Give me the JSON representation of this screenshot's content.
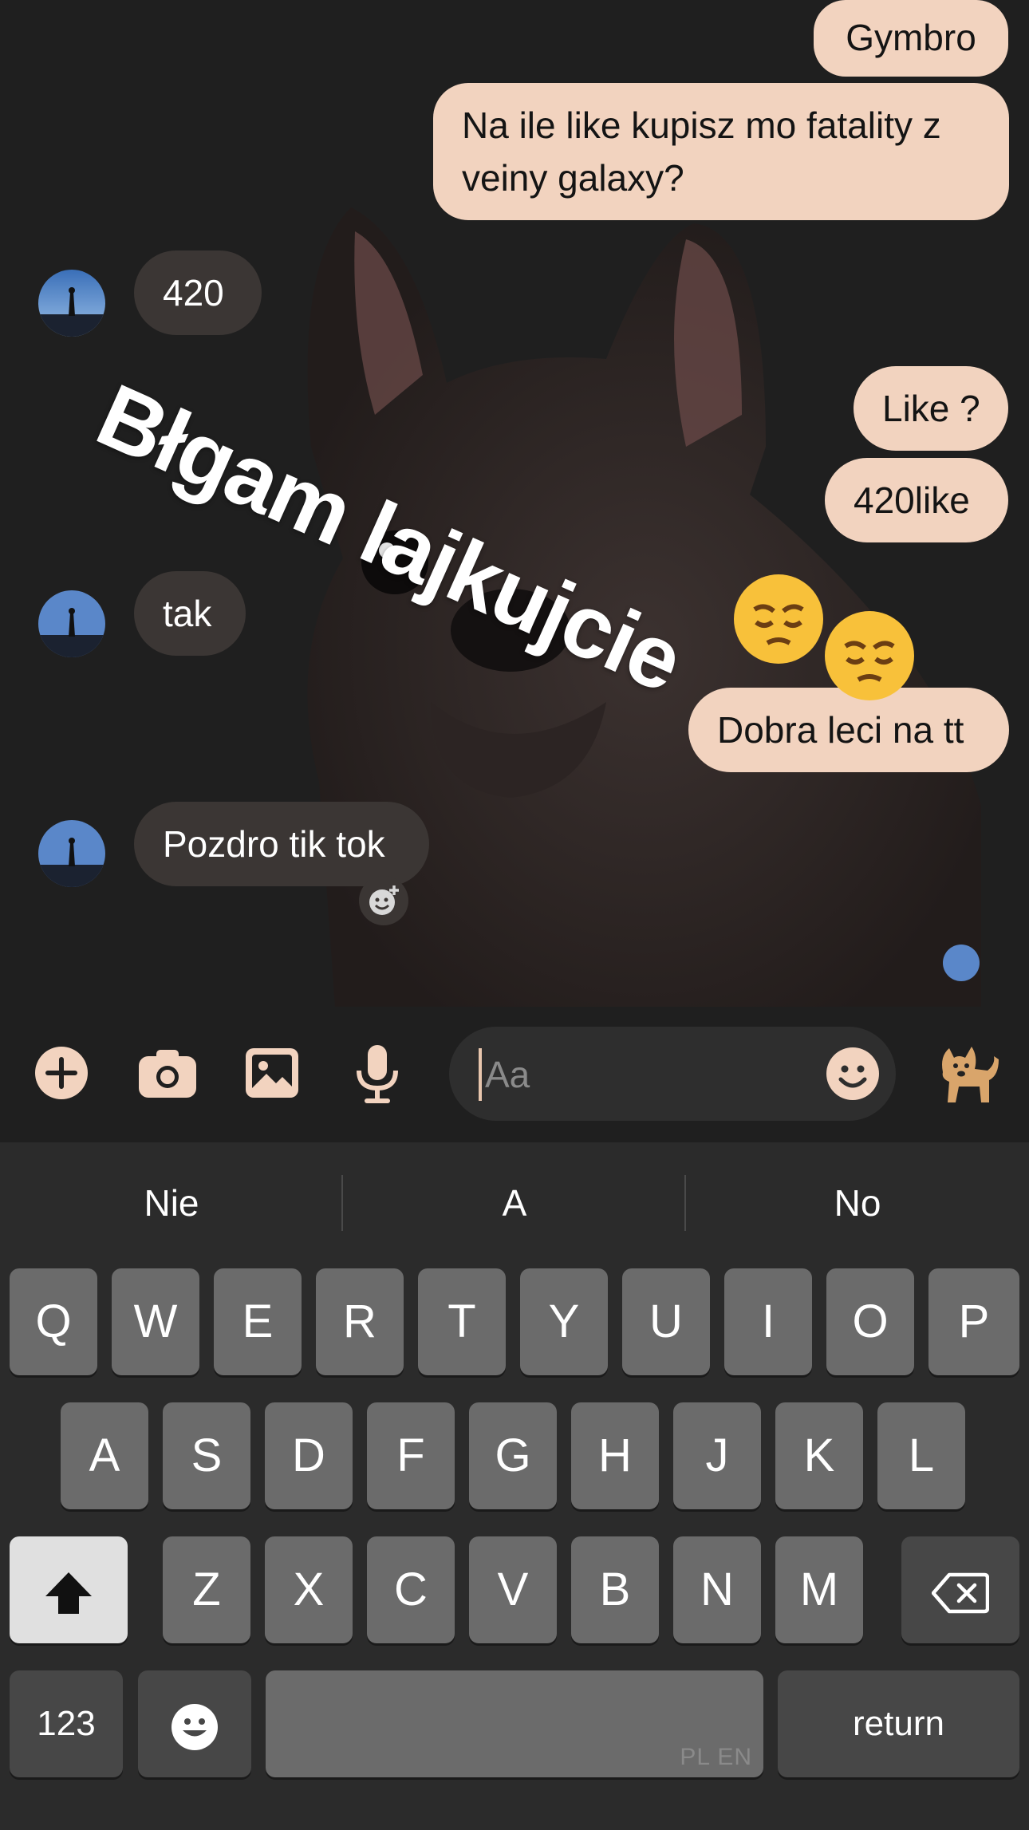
{
  "messages": {
    "out_1": "Gymbro",
    "out_2_line1": "Na ile like kupisz mo fatality z",
    "out_2_line2": "veiny galaxy?",
    "in_1": "420",
    "out_3": "Like ?",
    "out_4": "420like",
    "in_2": "tak",
    "out_5": "Dobra leci na tt",
    "in_3": "Pozdro tik tok"
  },
  "overlay_text": "Błgam lajkujcie",
  "composer": {
    "placeholder": "Aa",
    "icons": [
      "plus-icon",
      "camera-icon",
      "gallery-icon",
      "microphone-icon",
      "emoji-icon",
      "dog-sticker-icon"
    ]
  },
  "suggestions": [
    "Nie",
    "A",
    "No"
  ],
  "keyboard": {
    "row1": [
      "Q",
      "W",
      "E",
      "R",
      "T",
      "Y",
      "U",
      "I",
      "O",
      "P"
    ],
    "row2": [
      "A",
      "S",
      "D",
      "F",
      "G",
      "H",
      "J",
      "K",
      "L"
    ],
    "row3": [
      "Z",
      "X",
      "C",
      "V",
      "B",
      "N",
      "M"
    ],
    "numbers_label": "123",
    "return_label": "return",
    "language_label": "PL EN"
  },
  "colors": {
    "accent": "#f2d3bf",
    "incoming_bubble": "#3b3634",
    "background": "#1f1f1f"
  }
}
